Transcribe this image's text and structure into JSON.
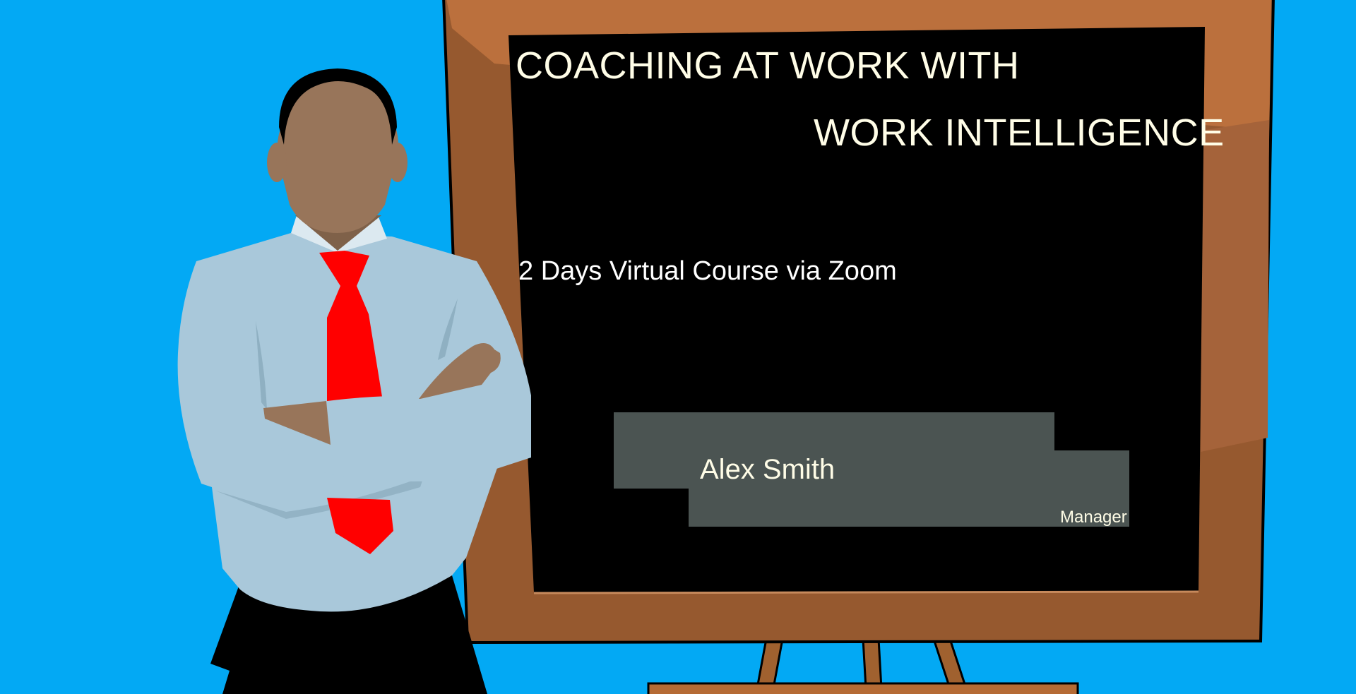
{
  "slide": {
    "title_line_1": "COACHING AT WORK WITH",
    "title_line_2": "WORK INTELLIGENCE",
    "subtitle": "2 Days Virtual Course via Zoom"
  },
  "presenter": {
    "name": "Alex Smith",
    "role": "Manager"
  },
  "colors": {
    "background": "#03a9f4",
    "board": "#000000",
    "frame": "#a0612f",
    "text": "#fffde7",
    "name_box": "#4b5452",
    "tie": "#ff0000",
    "shirt": "#a9c8da",
    "skin": "#98755a"
  },
  "illustration": {
    "figure": "man-with-crossed-arms",
    "board": "easel-chalkboard"
  }
}
